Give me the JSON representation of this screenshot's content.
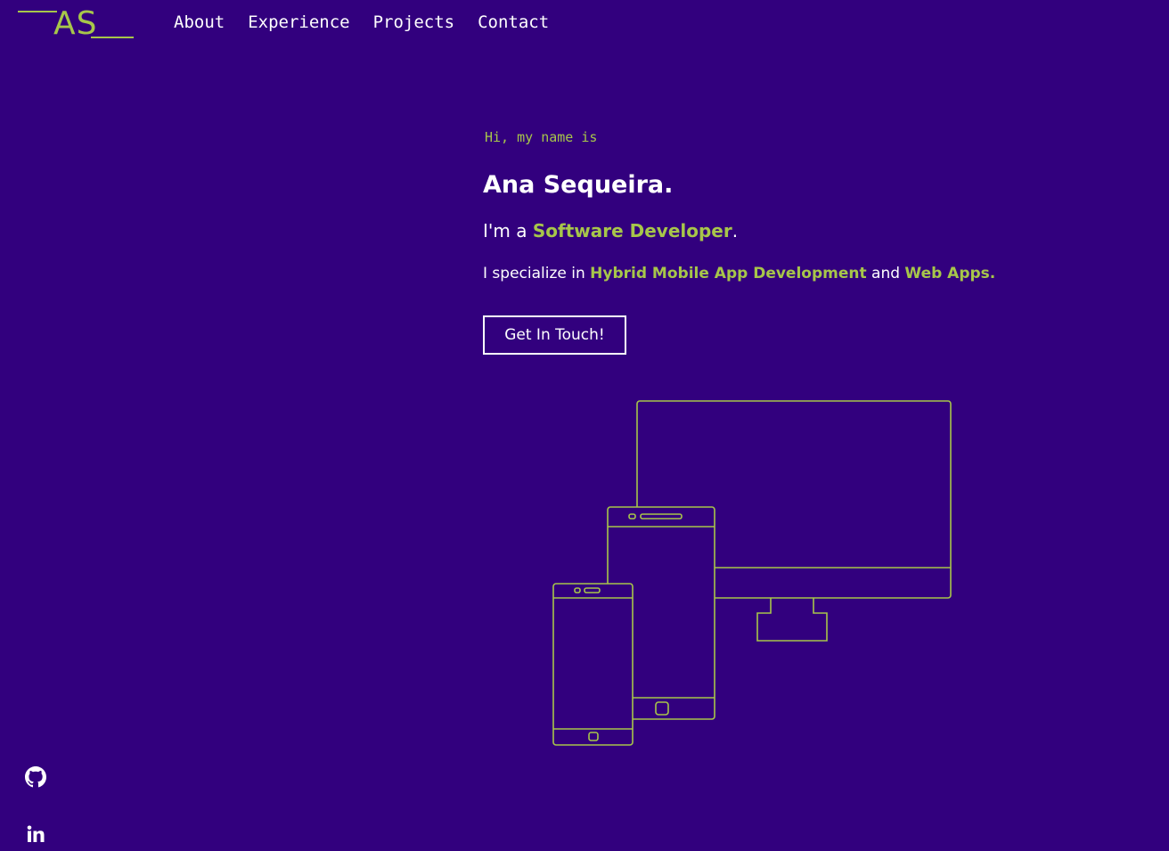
{
  "logo": {
    "text": "AS"
  },
  "nav": {
    "items": [
      {
        "label": "About"
      },
      {
        "label": "Experience"
      },
      {
        "label": "Projects"
      },
      {
        "label": "Contact"
      }
    ]
  },
  "hero": {
    "greeting": "Hi, my name is",
    "name": "Ana Sequeira.",
    "role_prefix": "I'm a ",
    "role_highlight": "Software Developer",
    "role_suffix": ".",
    "specialty_prefix": "I specialize in ",
    "specialty_highlight_1": "Hybrid Mobile App Development",
    "specialty_middle": " and ",
    "specialty_highlight_2": "Web Apps.",
    "cta_label": "Get In Touch!"
  },
  "social": {
    "github_icon": "github-icon",
    "linkedin_icon": "linkedin-icon"
  },
  "colors": {
    "background": "#32007e",
    "accent": "#a7c64a",
    "text": "#ffffff"
  }
}
